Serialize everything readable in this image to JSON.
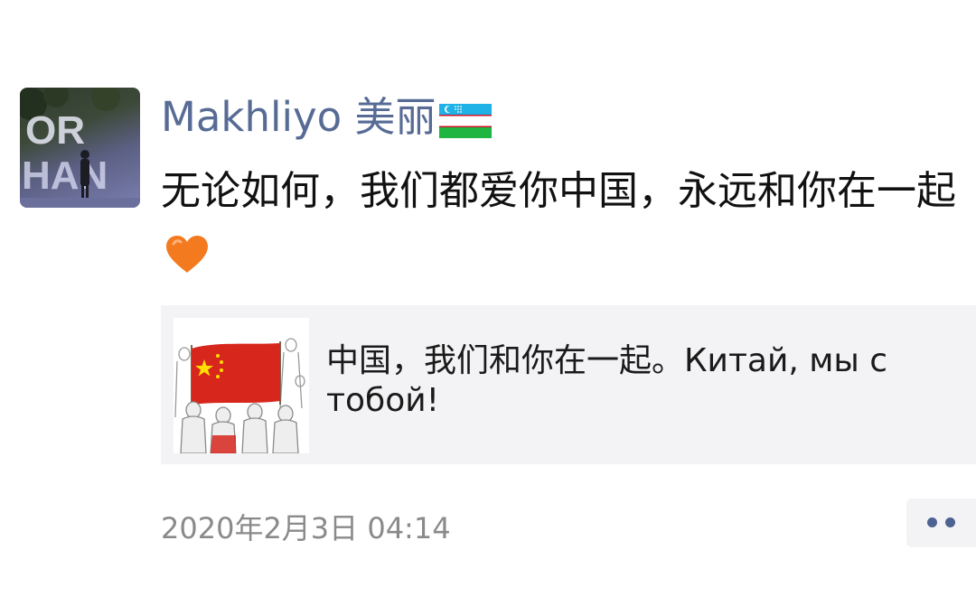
{
  "post": {
    "author": {
      "name": "Makhliyo 美丽",
      "flag_icon": "uzbekistan-flag-icon"
    },
    "text": "无论如何，我们都爱你中国，永远和你在一起",
    "emoji_icon": "orange-heart-icon",
    "shared_link": {
      "title": "中国，我们和你在一起。Китай, мы с тобой!",
      "thumbnail_icon": "china-flag-crowd-illustration"
    },
    "timestamp": "2020年2月3日 04:14",
    "more_button_icon": "more-dots-icon"
  },
  "colors": {
    "author_link": "#576b95",
    "text": "#111111",
    "timestamp": "#8a8a8a",
    "card_background": "#f3f3f5",
    "more_dots": "#4c6391",
    "china_red": "#d7261c",
    "china_star": "#ffde00"
  }
}
